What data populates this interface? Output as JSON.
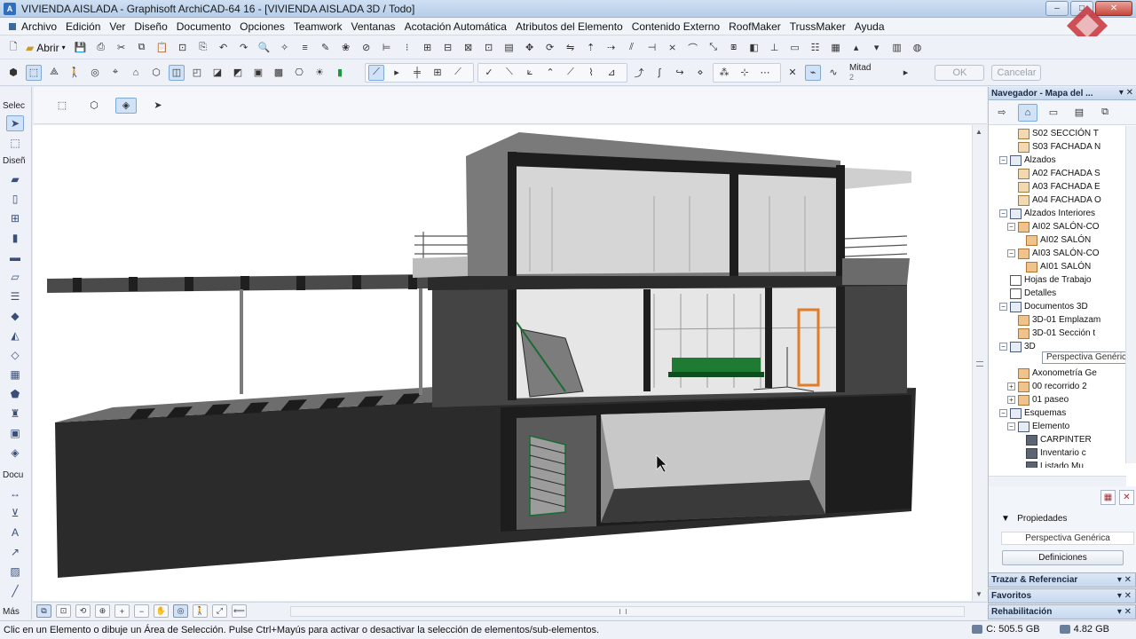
{
  "window": {
    "title": "VIVIENDA AISLADA - Graphisoft ArchiCAD-64 16 - [VIVIENDA AISLADA 3D / Todo]",
    "minimize": "–",
    "maximize": "□",
    "close": "✕"
  },
  "menu": [
    "Archivo",
    "Edición",
    "Ver",
    "Diseño",
    "Documento",
    "Opciones",
    "Teamwork",
    "Ventanas",
    "Acotación Automática",
    "Atributos del Elemento",
    "Contenido Externo",
    "RoofMaker",
    "TrussMaker",
    "Ayuda"
  ],
  "toolbar": {
    "open_label": "Abrir",
    "mitad_label": "Mitad",
    "mitad_value": "2",
    "ok_label": "OK",
    "cancel_label": "Cancelar"
  },
  "toolbox": {
    "sections": [
      "Selec",
      "Diseñ",
      "Docu",
      "Más"
    ]
  },
  "navigator": {
    "title": "Navegador - Mapa del ...",
    "items": [
      {
        "label": "S02 SECCIÓN T",
        "indent": 3,
        "icon": "house",
        "toggle": ""
      },
      {
        "label": "S03 FACHADA N",
        "indent": 3,
        "icon": "house",
        "toggle": ""
      },
      {
        "label": "Alzados",
        "indent": 2,
        "icon": "cube",
        "toggle": "−"
      },
      {
        "label": "A02 FACHADA S",
        "indent": 3,
        "icon": "house",
        "toggle": ""
      },
      {
        "label": "A03 FACHADA E",
        "indent": 3,
        "icon": "house",
        "toggle": ""
      },
      {
        "label": "A04 FACHADA O",
        "indent": 3,
        "icon": "house",
        "toggle": ""
      },
      {
        "label": "Alzados Interiores",
        "indent": 2,
        "icon": "cube",
        "toggle": "−"
      },
      {
        "label": "AI02 SALÓN-CO",
        "indent": 3,
        "icon": "orange",
        "toggle": "−"
      },
      {
        "label": "AI02 SALÓN",
        "indent": 4,
        "icon": "orange",
        "toggle": ""
      },
      {
        "label": "AI03 SALÓN-CO",
        "indent": 3,
        "icon": "orange",
        "toggle": "−"
      },
      {
        "label": "AI01 SALÓN",
        "indent": 4,
        "icon": "orange",
        "toggle": ""
      },
      {
        "label": "Hojas de Trabajo",
        "indent": 2,
        "icon": "sheet",
        "toggle": ""
      },
      {
        "label": "Detalles",
        "indent": 2,
        "icon": "sheet",
        "toggle": ""
      },
      {
        "label": "Documentos 3D",
        "indent": 2,
        "icon": "cube",
        "toggle": "−"
      },
      {
        "label": "3D-01 Emplazam",
        "indent": 3,
        "icon": "orange",
        "toggle": ""
      },
      {
        "label": "3D-01 Sección t",
        "indent": 3,
        "icon": "orange",
        "toggle": ""
      },
      {
        "label": "3D",
        "indent": 2,
        "icon": "cube",
        "toggle": "−"
      },
      {
        "label": "",
        "indent": 3,
        "icon": "",
        "toggle": ""
      },
      {
        "label": "Axonometría Ge",
        "indent": 3,
        "icon": "orange",
        "toggle": ""
      },
      {
        "label": "00 recorrido 2",
        "indent": 3,
        "icon": "orange",
        "toggle": "+"
      },
      {
        "label": "01 paseo",
        "indent": 3,
        "icon": "orange",
        "toggle": "+"
      },
      {
        "label": "Esquemas",
        "indent": 2,
        "icon": "cube",
        "toggle": "−"
      },
      {
        "label": "Elemento",
        "indent": 3,
        "icon": "cube",
        "toggle": "−"
      },
      {
        "label": "CARPINTER",
        "indent": 4,
        "icon": "dark",
        "toggle": ""
      },
      {
        "label": "Inventario c",
        "indent": 4,
        "icon": "dark",
        "toggle": ""
      },
      {
        "label": "Listado Mu",
        "indent": 4,
        "icon": "dark",
        "toggle": ""
      }
    ],
    "tooltip": "Perspectiva Genérica"
  },
  "properties": {
    "title": "Propiedades",
    "value": "Perspectiva Genérica",
    "button": "Definiciones"
  },
  "panels": {
    "trazar": "Trazar & Referenciar",
    "favoritos": "Favoritos",
    "rehabilitacion": "Rehabilitación"
  },
  "status": {
    "message": "Clic en un Elemento o dibuje un Área de Selección. Pulse Ctrl+Mayús para activar o desactivar la selección de elementos/sub-elementos.",
    "disk": "C: 505.5 GB",
    "memory": "4.82 GB"
  },
  "colors": {
    "title_bar": "#cfe0f3",
    "panel_head": "#c6d7ee",
    "building_dark": "#2b2b2b",
    "accent_orange": "#e07c2a",
    "furniture_green": "#1f7a33"
  }
}
